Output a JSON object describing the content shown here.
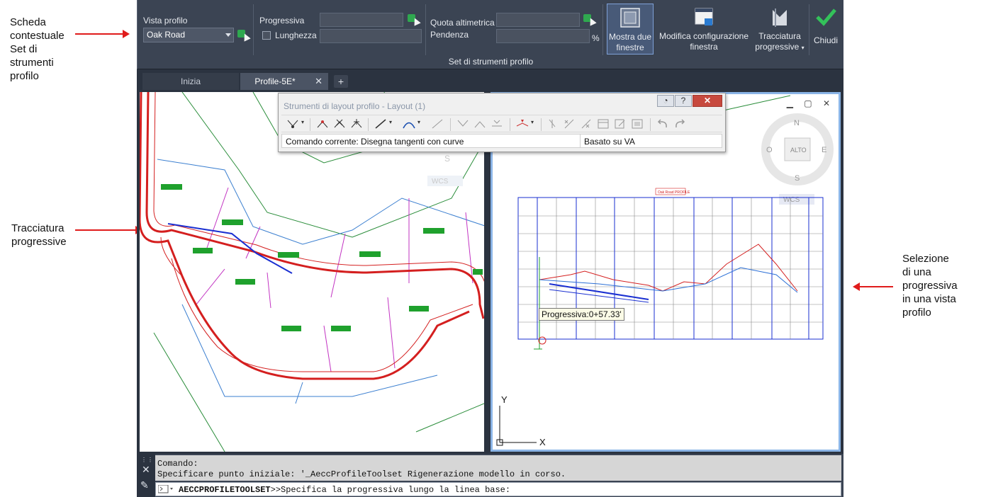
{
  "annotations": {
    "contextual_tab": [
      "Scheda",
      "contestuale",
      "Set di",
      "strumenti",
      "profilo"
    ],
    "station_tracking": [
      "Tracciatura",
      "progressive"
    ],
    "station_selection": [
      "Selezione",
      "di una",
      "progressiva",
      "in una vista",
      "profilo"
    ]
  },
  "ribbon": {
    "profile_view_label": "Vista profilo",
    "profile_view_value": "Oak Road",
    "station_label": "Progressiva",
    "station_value": "",
    "length_label": "Lunghezza",
    "length_value": "",
    "elevation_label": "Quota altimetrica",
    "elevation_value": "",
    "grade_label": "Pendenza",
    "grade_value": "",
    "grade_unit": "%",
    "buttons": {
      "two_windows": [
        "Mostra due",
        "finestre"
      ],
      "edit_window_config": [
        "Modifica configurazione",
        "finestra"
      ],
      "station_tracking": [
        "Tracciatura",
        "progressive"
      ],
      "close": "Chiudi"
    },
    "panel_title": "Set di strumenti profilo"
  },
  "tabs": {
    "start": "Inizia",
    "drawing": "Profile-5E*",
    "add": "+",
    "close": "✕"
  },
  "toolbar": {
    "title": "Strumenti di layout profilo - Layout (1)",
    "help": "?",
    "close": "✕",
    "current_command": "Comando corrente: Disegna tangenti con curve",
    "mode": "Basato su VA"
  },
  "viewcube": {
    "north": "N",
    "south": "S",
    "east": "E",
    "west": "O",
    "top": "ALTO",
    "wcs": "WCS"
  },
  "viewport_left": {
    "wcs": "WCS",
    "south": "S"
  },
  "profile_view": {
    "title": "Oak Road PROFILE",
    "tooltip": "Progressiva:0+57.33'",
    "ucs_x": "X",
    "ucs_y": "Y"
  },
  "command_line": {
    "history_1": "Comando:",
    "history_2": "Specificare punto iniziale: '_AeccProfileToolset Rigenerazione modello in corso.",
    "command_name": "AECCPROFILETOOLSET",
    "prompt": ">>Specifica la progressiva lungo la linea base:"
  },
  "colors": {
    "ribbon_bg": "#3b4453",
    "app_bg": "#2b3340",
    "accent_green": "#2fa84f",
    "annotation_arrow": "#e01b1b",
    "active_viewport_border": "#8ab4e6"
  }
}
